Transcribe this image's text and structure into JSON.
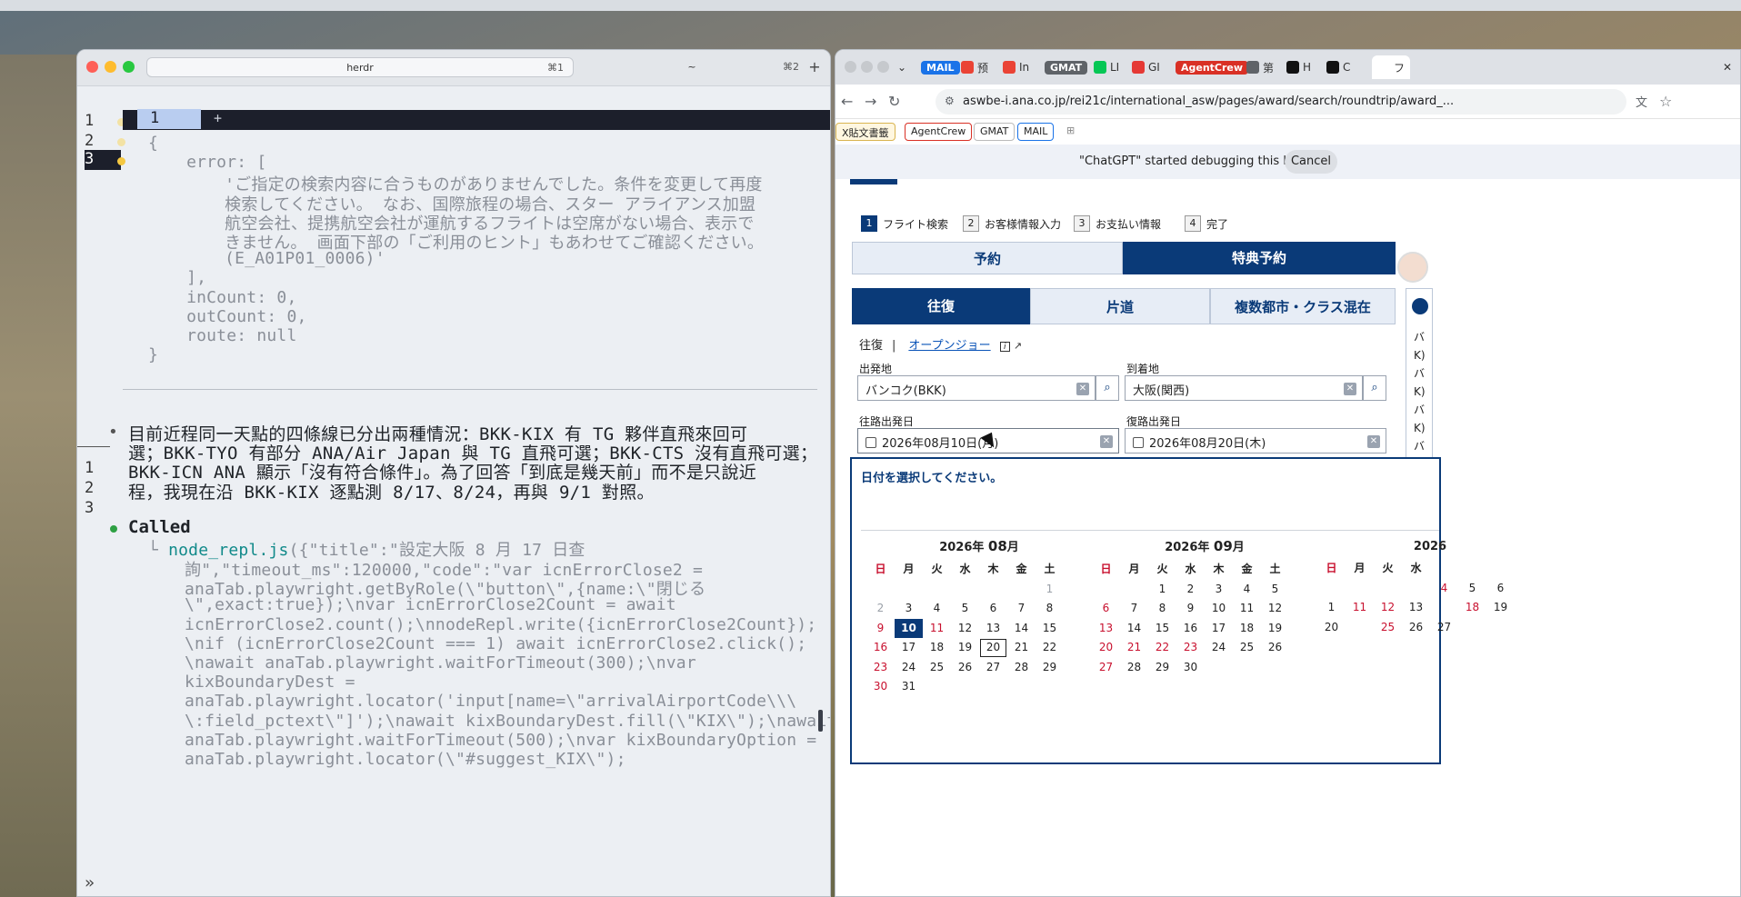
{
  "terminal": {
    "tabs": [
      {
        "title": "herdr",
        "shortcut": "⌘1"
      },
      {
        "title": "~",
        "shortcut": "⌘2"
      }
    ],
    "new_tab": "+",
    "gutter_top": [
      "1",
      "2",
      "3"
    ],
    "mini_bar_num": "1",
    "mini_bar_plus": "+",
    "code_lines": [
      "{",
      "  error: [",
      "    'ご指定の検索内容に合うものがありませんでした。条件を変更して再度",
      "    検索してください。 なお、国際旅程の場合、スター アライアンス加盟",
      "    航空会社、提携航空会社が運航するフライトは空席がない場合、表示で",
      "    きません。 画面下部の「ご利用のヒント」もあわせてご確認ください。",
      "    (E_A01P01_0006)'",
      "  ],",
      "  inCount: 0,",
      "  outCount: 0,",
      "  route: null",
      "}"
    ],
    "gutter_bottom": [
      "1",
      "2",
      "3"
    ],
    "message_bullet": "•",
    "message_lines": [
      "目前近程同一天點的四條線已分出兩種情況：BKK-KIX 有 TG 夥伴直飛來回可",
      "選；BKK-TYO 有部分 ANA/Air Japan 與 TG 直飛可選；BKK-CTS 沒有直飛可選；",
      "BKK-ICN ANA 顯示「沒有符合條件」。為了回答「到底是幾天前」而不是只說近",
      "程，我現在沿 BKK-KIX 逐點測 8/17、8/24，再與 9/1 對照。"
    ],
    "called_label": "Called",
    "tree_glyph": "└",
    "call_fn": "node_repl",
    "call_method": ".js",
    "call_first": "({\"title\":\"設定大阪 8 月 17 日查",
    "call_lines": [
      "詢\",\"timeout_ms\":120000,\"code\":\"var icnErrorClose2 =",
      "anaTab.playwright.getByRole(\\\"button\\\",{name:\\\"閉じる",
      "\\\",exact:true});\\nvar icnErrorClose2Count = await",
      "icnErrorClose2.count();\\nnodeRepl.write({icnErrorClose2Count});",
      "\\nif (icnErrorClose2Count === 1) await icnErrorClose2.click();",
      "\\nawait anaTab.playwright.waitForTimeout(300);\\nvar",
      "kixBoundaryDest =",
      "anaTab.playwright.locator('input[name=\\\"arrivalAirportCode\\\\\\",
      "\\:field_pctext\\\"]');\\nawait kixBoundaryDest.fill(\\\"KIX\\\");\\nawait",
      "anaTab.playwright.waitForTimeout(500);\\nvar kixBoundaryOption =",
      "anaTab.playwright.locator(\\\"#suggest_KIX\\\");"
    ],
    "prompt": "»"
  },
  "browser": {
    "tabs": [
      {
        "label": "MAIL",
        "pill": true,
        "color": "#1a73e8"
      },
      {
        "label": "预",
        "icon": "gmail"
      },
      {
        "label": "In",
        "icon": "gmail"
      },
      {
        "label": "GMAT",
        "pill": true,
        "color": "#5f6368"
      },
      {
        "label": "LI",
        "icon": "line"
      },
      {
        "label": "GI",
        "icon": "red"
      },
      {
        "label": "AgentCrew",
        "pill": true,
        "color": "#d93025"
      },
      {
        "label": "第",
        "icon": "globe"
      },
      {
        "label": "H",
        "icon": "threads"
      },
      {
        "label": "C",
        "icon": "chatgpt"
      },
      {
        "label": "フ",
        "icon": "active"
      }
    ],
    "url": "aswbe-i.ana.co.jp/rei21c/international_asw/pages/award/search/roundtrip/award_...",
    "bookmarks": [
      "X貼文書籤",
      "AgentCrew",
      "GMAT",
      "MAIL"
    ],
    "debug_message": "\"ChatGPT\" started debugging this browser",
    "debug_cancel": "Cancel",
    "steps": [
      {
        "num": "1",
        "label": "フライト検索",
        "active": true
      },
      {
        "num": "2",
        "label": "お客様情報入力"
      },
      {
        "num": "3",
        "label": "お支払い情報"
      },
      {
        "num": "4",
        "label": "完了"
      }
    ],
    "main_tabs": [
      "予約",
      "特典予約"
    ],
    "trip_tabs": [
      "往復",
      "片道",
      "複数都市・クラス混在"
    ],
    "sub": {
      "current": "往復",
      "open_jaw": "オープンジョー",
      "info": "i"
    },
    "origin_label": "出発地",
    "origin_value": "バンコク(BKK)",
    "dest_label": "到着地",
    "dest_value": "大阪(関西)",
    "outbound_label": "往路出発日",
    "outbound_value": "2026年08月10日(月)",
    "return_label": "復路出発日",
    "return_value": "2026年08月20日(木)",
    "right_items": [
      "バ",
      "K)",
      "バ",
      "K)",
      "バ",
      "K)",
      "バ"
    ],
    "calendar": {
      "prompt": "日付を選択してください。",
      "weekdays": [
        "日",
        "月",
        "火",
        "水",
        "木",
        "金",
        "土"
      ],
      "months": [
        {
          "year": "2026年",
          "month": "08",
          "suffix": "月",
          "days": [
            "",
            "",
            "",
            "",
            "",
            "",
            "1",
            "2",
            "3",
            "4",
            "5",
            "6",
            "7",
            "8",
            "9",
            "10",
            "11",
            "12",
            "13",
            "14",
            "15",
            "16",
            "17",
            "18",
            "19",
            "20",
            "21",
            "22",
            "23",
            "24",
            "25",
            "26",
            "27",
            "28",
            "29",
            "30",
            "31",
            "",
            "",
            "",
            "",
            ""
          ]
        },
        {
          "year": "2026年",
          "month": "09",
          "suffix": "月",
          "days": [
            "",
            "",
            "1",
            "2",
            "3",
            "4",
            "5",
            "6",
            "7",
            "8",
            "9",
            "10",
            "11",
            "12",
            "13",
            "14",
            "15",
            "16",
            "17",
            "18",
            "19",
            "20",
            "21",
            "22",
            "23",
            "24",
            "25",
            "26",
            "27",
            "28",
            "29",
            "30",
            "",
            "",
            ""
          ]
        },
        {
          "year": "2026",
          "month": "",
          "suffix": "",
          "days": [
            "",
            "",
            "",
            "",
            "",
            "",
            "",
            "4",
            "5",
            "6",
            "1",
            "",
            "",
            "",
            "11",
            "12",
            "13",
            "",
            "",
            "",
            "",
            "18",
            "19",
            "20",
            "",
            "",
            "",
            "",
            "25",
            "26",
            "27",
            "",
            "",
            "",
            ""
          ]
        }
      ],
      "selected_out": "10",
      "selected_ret": "20"
    }
  }
}
